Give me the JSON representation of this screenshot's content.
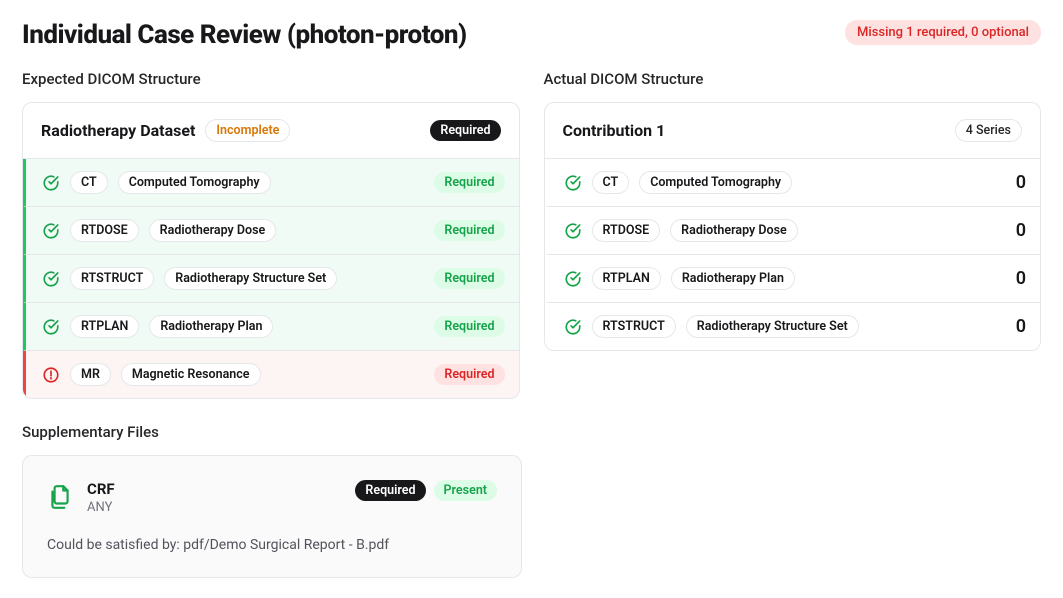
{
  "header": {
    "title": "Individual Case Review (photon-proton)",
    "missing_text": "Missing 1 required, 0 optional"
  },
  "expected": {
    "section_title": "Expected DICOM Structure",
    "dataset_title": "Radiotherapy Dataset",
    "incomplete_label": "Incomplete",
    "required_label": "Required",
    "rows": [
      {
        "code": "CT",
        "desc": "Computed Tomography",
        "status": "ok",
        "badge": "Required",
        "badge_style": "green"
      },
      {
        "code": "RTDOSE",
        "desc": "Radiotherapy Dose",
        "status": "ok",
        "badge": "Required",
        "badge_style": "green"
      },
      {
        "code": "RTSTRUCT",
        "desc": "Radiotherapy Structure Set",
        "status": "ok",
        "badge": "Required",
        "badge_style": "green"
      },
      {
        "code": "RTPLAN",
        "desc": "Radiotherapy Plan",
        "status": "ok",
        "badge": "Required",
        "badge_style": "green"
      },
      {
        "code": "MR",
        "desc": "Magnetic Resonance",
        "status": "error",
        "badge": "Required",
        "badge_style": "red"
      }
    ]
  },
  "actual": {
    "section_title": "Actual DICOM Structure",
    "contribution_title": "Contribution 1",
    "series_label": "4 Series",
    "rows": [
      {
        "code": "CT",
        "desc": "Computed Tomography",
        "count": "0"
      },
      {
        "code": "RTDOSE",
        "desc": "Radiotherapy Dose",
        "count": "0"
      },
      {
        "code": "RTPLAN",
        "desc": "Radiotherapy Plan",
        "count": "0"
      },
      {
        "code": "RTSTRUCT",
        "desc": "Radiotherapy Structure Set",
        "count": "0"
      }
    ]
  },
  "supp": {
    "section_title": "Supplementary Files",
    "name": "CRF",
    "type": "ANY",
    "required_label": "Required",
    "present_label": "Present",
    "satisfied_text": "Could be satisfied by: pdf/Demo Surgical Report - B.pdf"
  }
}
